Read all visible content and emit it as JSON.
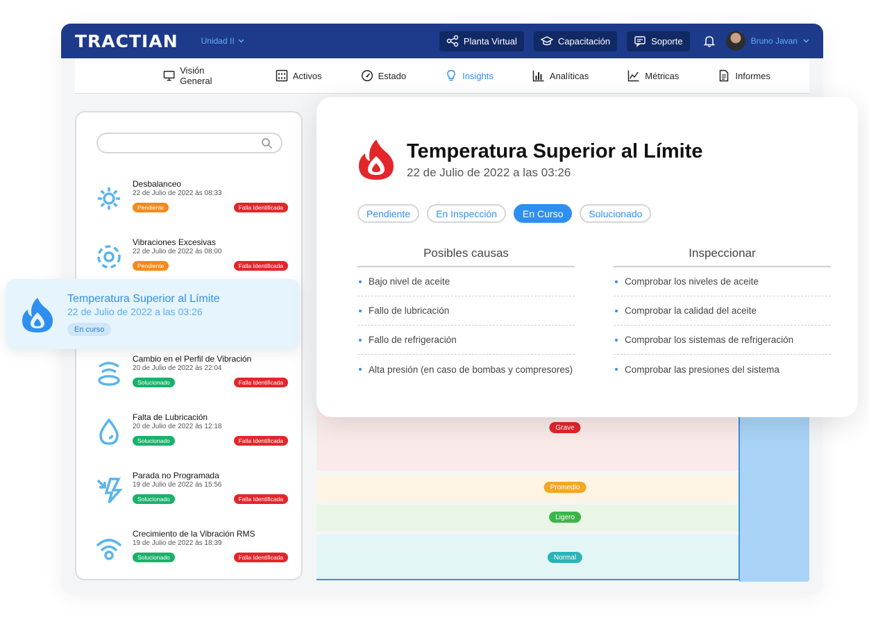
{
  "header": {
    "logo": "TRACTIAN",
    "unit_selector": "Unidad II",
    "buttons": [
      {
        "label": "Planta Virtual",
        "icon": "network-icon"
      },
      {
        "label": "Capacitación",
        "icon": "graduation-cap-icon"
      },
      {
        "label": "Soporte",
        "icon": "chat-icon"
      }
    ],
    "user_name": "Bruno Javan"
  },
  "nav": {
    "items": [
      {
        "label": "Visión General",
        "icon": "monitor-icon"
      },
      {
        "label": "Activos",
        "icon": "asset-icon"
      },
      {
        "label": "Estado",
        "icon": "gauge-icon"
      },
      {
        "label": "Insights",
        "icon": "lightbulb-icon",
        "active": true
      },
      {
        "label": "Analíticas",
        "icon": "bar-chart-icon"
      },
      {
        "label": "Métricas",
        "icon": "line-chart-icon"
      },
      {
        "label": "Informes",
        "icon": "document-icon"
      }
    ]
  },
  "insights": [
    {
      "title": "Desbalanceo",
      "date": "22 de Julio de 2022 às 08:33",
      "status": "Pendiente",
      "tag": "Falla Identificada",
      "icon": "gear-icon"
    },
    {
      "title": "Vibraciones Excesivas",
      "date": "22 de Julio de 2022 às 08:00",
      "status": "Pendiente",
      "tag": "Falla Identificada",
      "icon": "vibration-icon"
    },
    {
      "title": "Cambio en el Perfil de Vibración",
      "date": "20 de Julio de 2022 às 22:04",
      "status": "Solucionado",
      "tag": "Falla Identificada",
      "icon": "wave-icon"
    },
    {
      "title": "Falta de Lubricación",
      "date": "20 de Julio de 2022 às 12:18",
      "status": "Solucionado",
      "tag": "Falla Identificada",
      "icon": "drop-icon"
    },
    {
      "title": "Parada no Programada",
      "date": "19 de Julio de 2022 às 15:56",
      "status": "Solucionado",
      "tag": "Falla Identificada",
      "icon": "stop-icon"
    },
    {
      "title": "Crecimiento de la Vibración RMS",
      "date": "19 de Julio de 2022 às 18:39",
      "status": "Solucionado",
      "tag": "Falla Identificada",
      "icon": "signal-icon"
    }
  ],
  "selected": {
    "title": "Temperatura Superior al Límite",
    "date": "22 de Julio de 2022 a las 03:26",
    "status": "En curso"
  },
  "detail": {
    "title": "Temperatura Superior al Límite",
    "date": "22 de Julio de 2022 a las 03:26",
    "statuses": [
      "Pendiente",
      "En Inspección",
      "En Curso",
      "Solucionado"
    ],
    "active_status": "En Curso",
    "causes_title": "Posibles causas",
    "causes": [
      "Bajo nivel de aceite",
      "Fallo de lubricación",
      "Fallo de refrigeración",
      "Alta presión (en caso de bombas y compresores)"
    ],
    "inspect_title": "Inspeccionar",
    "inspect": [
      "Comprobar los niveles de aceite",
      "Comprobar la calidad del aceite",
      "Comprobar los sistemas de refrigeración",
      "Comprobar las presiones del sistema"
    ]
  },
  "severity": {
    "levels": [
      "Grave",
      "Promedio",
      "Ligero",
      "Normal"
    ]
  },
  "colors": {
    "brand": "#1e3a8a",
    "accent": "#2f8ff0",
    "pendiente": "#f28a1c",
    "solucionado": "#19b26b",
    "falla": "#e3262b",
    "fire": "#e3262b"
  }
}
